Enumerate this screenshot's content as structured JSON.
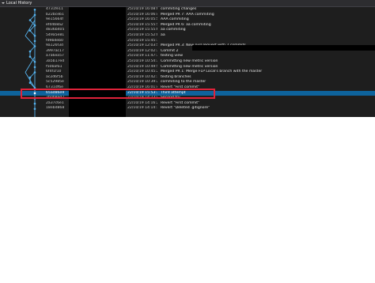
{
  "panel": {
    "title": "Local History"
  },
  "commits": [
    {
      "hash": "4731fe11",
      "date": "25/10/19 16:08:07",
      "message": "commiting changes"
    },
    {
      "hash": "b22bceb1",
      "date": "25/10/19 16:06:48",
      "message": "Merged PR 7: AAA commiting"
    },
    {
      "hash": "9e15664f",
      "date": "25/10/19 16:05:56",
      "message": "AAA commiting"
    },
    {
      "hash": "efd4b8a2",
      "date": "25/10/19 15:55:50",
      "message": "Merged PR 6: aa commiting"
    },
    {
      "hash": "4836b405",
      "date": "25/10/19 15:55:04",
      "message": "aa commiting"
    },
    {
      "hash": "549a5e81",
      "date": "25/10/19 15:52:06",
      "message": "aa"
    },
    {
      "hash": "fd9bdeb0",
      "date": "25/10/19 15:45:11",
      "message": ""
    },
    {
      "hash": "9a126f3d",
      "date": "25/10/19 12:03:54",
      "message": "Merged PR 3: New pull request with 2 commits"
    },
    {
      "hash": "3997ac17",
      "date": "25/10/19 12:02:35",
      "message": "Commit 2"
    },
    {
      "hash": "a7a6ea57",
      "date": "25/10/19 11:47:34",
      "message": "testing view"
    },
    {
      "hash": "3a5b17ed",
      "date": "25/10/19 10:54:31",
      "message": "Committing new metric version"
    },
    {
      "hash": "f50bafa1",
      "date": "25/10/19 10:49:51",
      "message": "Committing new metric version"
    },
    {
      "hash": "6f4f1f10",
      "date": "25/10/19 10:45:25",
      "message": "Merged PR 1: Merge FLP Local's branch with the master"
    },
    {
      "hash": "ac2d6f5b",
      "date": "25/10/19 10:42:15",
      "message": "testing branches"
    },
    {
      "hash": "5c52985e",
      "date": "25/10/19 10:39:28",
      "message": "commiting to the master"
    },
    {
      "hash": "6731df6e",
      "date": "22/10/19 16:01:41",
      "message": "Revert \"First commit\""
    },
    {
      "hash": "65ad86e9",
      "date": "22/10/19 15:53:35",
      "message": "Third attempt"
    },
    {
      "hash": "2b0b8ed7",
      "date": "22/10/19 14:23:42",
      "message": "Second try"
    },
    {
      "hash": "2a37c6e1",
      "date": "22/10/19 14:16:26",
      "message": "Revert \"First commit\""
    },
    {
      "hash": "18ebd868",
      "date": "22/10/19 14:14:16",
      "message": "Revert \"Deleted .gitignore\""
    }
  ],
  "selected_index": 16,
  "colors": {
    "graph": "#56b4f0",
    "selection": "#0e639c",
    "highlight": "#e0223a"
  }
}
